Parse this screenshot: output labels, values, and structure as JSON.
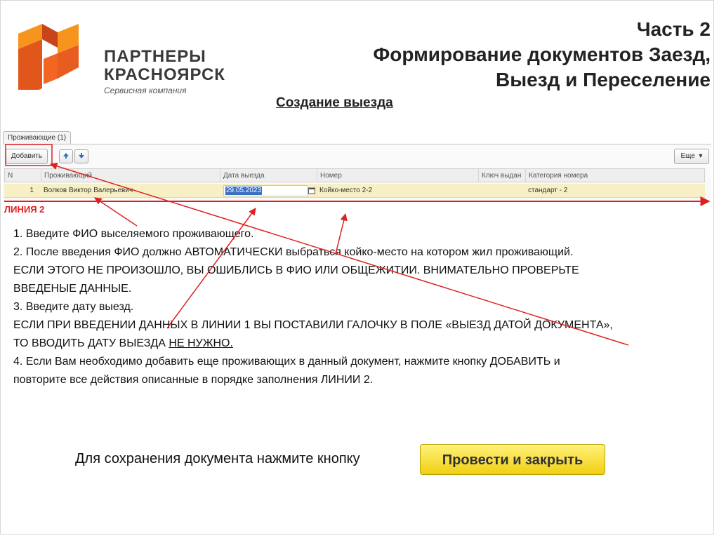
{
  "logo": {
    "line1": "ПАРТНЕРЫ",
    "line2": "КРАСНОЯРСК",
    "sub": "Сервисная компания",
    "color": "#f26522"
  },
  "header": {
    "title_lines": [
      "Часть 2",
      "Формирование документов Заезд,",
      "Выезд и Переселение"
    ],
    "subtitle": "Создание выезда"
  },
  "form": {
    "tab_label": "Проживающие (1)",
    "add_button": "Добавить",
    "more_button": "Еще",
    "columns": [
      "N",
      "Проживающий",
      "Дата выезда",
      "Номер",
      "Ключ выдан",
      "Категория номера"
    ],
    "rows": [
      {
        "n": "1",
        "resident": "Волков Виктор Валерьевич",
        "date": "29.05.2023",
        "room": "Койко-место 2-2",
        "key": "",
        "category": "стандарт - 2"
      }
    ]
  },
  "instructions": {
    "line_label": "ЛИНИЯ 2",
    "step1": "1. Введите ФИО выселяемого проживающего.",
    "step2a": "2. После введения ФИО должно АВТОМАТИЧЕСКИ выбраться койко-место на котором жил проживающий.",
    "step2b": "ЕСЛИ ЭТОГО НЕ ПРОИЗОШЛО, ВЫ ОШИБЛИСЬ В ФИО ИЛИ ОБЩЕЖИТИИ. ВНИМАТЕЛЬНО ПРОВЕРЬТЕ",
    "step2c": "ВВЕДЕНЫЕ ДАННЫЕ.",
    "step3": "3. Введите дату выезд.",
    "step3b": "ЕСЛИ ПРИ ВВЕДЕНИИ ДАННЫХ В ЛИНИИ 1 ВЫ ПОСТАВИЛИ ГАЛОЧКУ В ПОЛЕ «ВЫЕЗД ДАТОЙ ДОКУМЕНТА»,",
    "step3c_pre": "ТО ВВОДИТЬ ДАТУ ВЫЕЗДА ",
    "step3c_underlined": "НЕ НУЖНО.",
    "step4a": "4. Если Вам необходимо добавить еще проживающих в данный документ, нажмите кнопку ДОБАВИТЬ и",
    "step4b": "повторите все действия описанные в порядке заполнения ЛИНИИ 2."
  },
  "save": {
    "text": "Для сохранения документа нажмите кнопку",
    "button": "Провести и закрыть"
  },
  "colors": {
    "annotation_red": "#e02020",
    "row_highlight": "#f7f0c4",
    "button_yellow": "#f1cf12"
  }
}
